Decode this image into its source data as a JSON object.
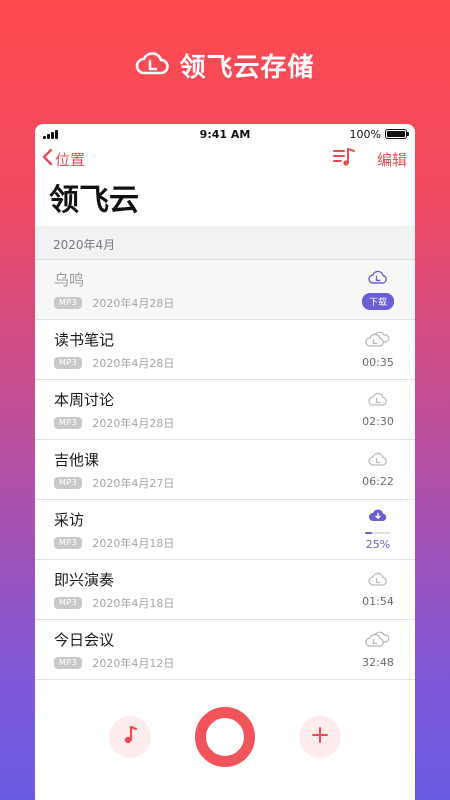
{
  "promo": {
    "title": "领飞云存储"
  },
  "status_bar": {
    "time": "9:41 AM",
    "battery": "100%"
  },
  "nav": {
    "back_label": "位置",
    "edit_label": "编辑"
  },
  "page": {
    "title": "领飞云"
  },
  "section": {
    "header": "2020年4月"
  },
  "badge_label": "MP3",
  "recordings": [
    {
      "title": "乌鸣",
      "date": "2020年4月28日",
      "status": "cloud",
      "action_label": "下载"
    },
    {
      "title": "读书笔记",
      "date": "2020年4月28日",
      "status": "synced",
      "duration": "00:35"
    },
    {
      "title": "本周讨论",
      "date": "2020年4月28日",
      "status": "local",
      "duration": "02:30"
    },
    {
      "title": "吉他课",
      "date": "2020年4月27日",
      "status": "local",
      "duration": "06:22"
    },
    {
      "title": "采访",
      "date": "2020年4月18日",
      "status": "downloading",
      "progress": 0.25,
      "progress_label": "25%"
    },
    {
      "title": "即兴演奏",
      "date": "2020年4月18日",
      "status": "local",
      "duration": "01:54"
    },
    {
      "title": "今日会议",
      "date": "2020年4月12日",
      "status": "synced",
      "duration": "32:48"
    }
  ],
  "colors": {
    "accent": "#f24a52",
    "purple": "#6a5fd6"
  },
  "icons": {
    "promo": "cloud-logo-icon",
    "back": "chevron-left-icon",
    "playlist": "playlist-music-icon",
    "music": "music-note-icon",
    "record": "record-button",
    "add": "plus-icon"
  }
}
